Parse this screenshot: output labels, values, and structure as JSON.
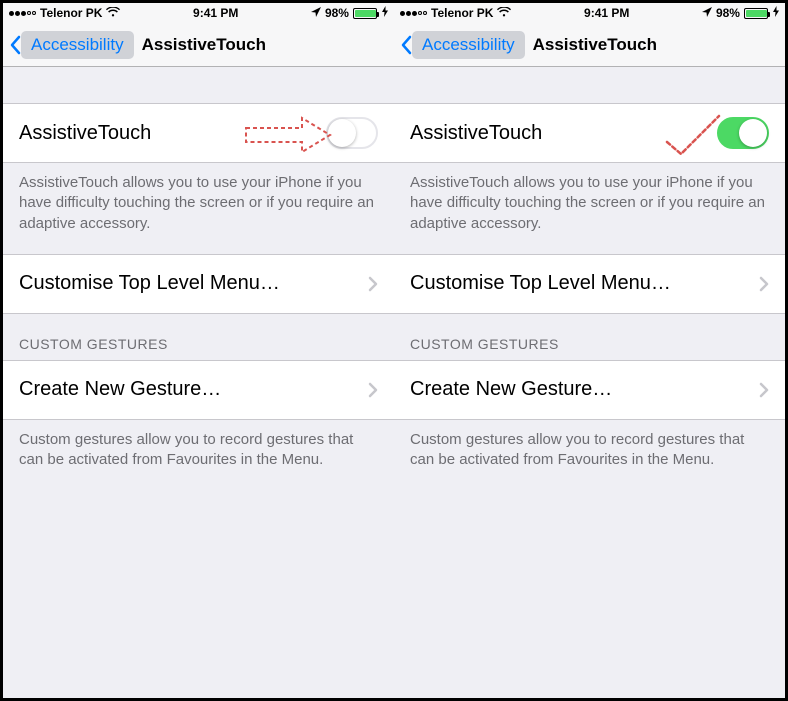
{
  "statusbar": {
    "carrier": "Telenor PK",
    "time": "9:41 PM",
    "battery_pct": "98%"
  },
  "nav": {
    "back_label": "Accessibility",
    "title": "AssistiveTouch"
  },
  "rows": {
    "assistive_label": "AssistiveTouch",
    "assistive_footer": "AssistiveTouch allows you to use your iPhone if you have difficulty touching the screen or if you require an adaptive accessory.",
    "customise_label": "Customise Top Level Menu…",
    "gestures_header": "CUSTOM GESTURES",
    "create_gesture_label": "Create New Gesture…",
    "gestures_footer": "Custom gestures allow you to record gestures that can be activated from Favourites in the Menu."
  },
  "panels": {
    "left": {
      "toggle_state": "off",
      "annotation": "arrow"
    },
    "right": {
      "toggle_state": "on",
      "annotation": "check"
    }
  },
  "colors": {
    "ios_green": "#4cd964",
    "ios_blue": "#007aff",
    "annotation_red": "#d9534f"
  }
}
